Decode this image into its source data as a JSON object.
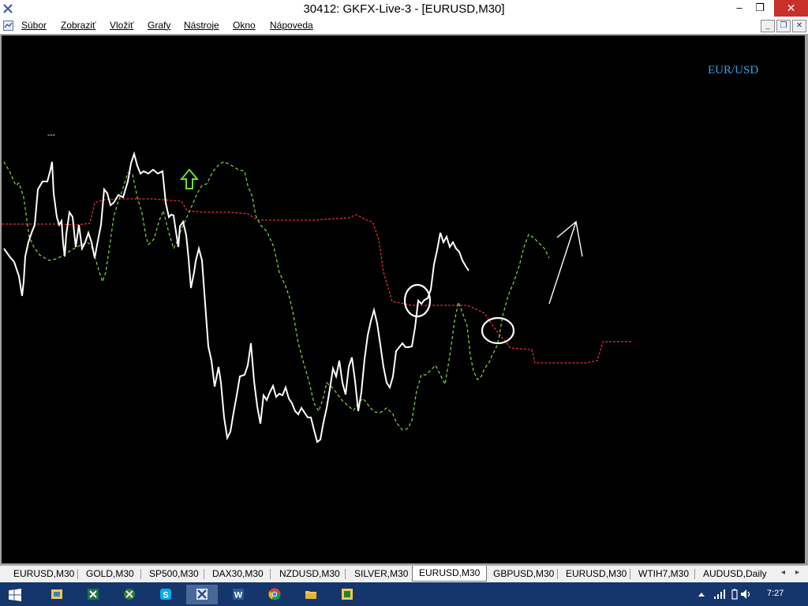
{
  "window": {
    "title": "30412: GKFX-Live-3 - [EURUSD,M30]",
    "min_glyph": "–",
    "max_glyph": "❐",
    "close_glyph": "✕"
  },
  "menu": {
    "items": [
      "Súbor",
      "Zobraziť",
      "Vložiť",
      "Grafy",
      "Nástroje",
      "Okno",
      "Nápoveda"
    ],
    "mdi_min": "_",
    "mdi_restore": "❐",
    "mdi_close": "✕"
  },
  "chart": {
    "symbol_label": "EUR/USD",
    "marker_text": "---",
    "colors": {
      "background": "#000000",
      "price_line": "#ffffff",
      "lagging_line": "#7fd84b",
      "cloud_line": "#e03131",
      "arrow_up": "#66dd33",
      "symbol_label": "#33a4e3"
    },
    "annotations": [
      "up-arrow-marker",
      "circle-1",
      "circle-2",
      "hand-drawn-arrow"
    ]
  },
  "tabs": {
    "items": [
      "EURUSD,M30",
      "GOLD,M30",
      "SP500,M30",
      "DAX30,M30",
      "NZDUSD,M30",
      "SILVER,M30",
      "EURUSD,M30",
      "GBPUSD,M30",
      "EURUSD,M30",
      "WTIH7,M30",
      "AUDUSD,Daily"
    ],
    "active_index": 6,
    "scroll_left": "◂",
    "scroll_right": "▸"
  },
  "taskbar": {
    "apps": [
      "windows-start",
      "file-explorer-folder",
      "excel",
      "xbox",
      "skype",
      "metatrader",
      "word",
      "chrome",
      "file-explorer",
      "trading-app"
    ],
    "active_app": "metatrader",
    "clock": "7:27"
  }
}
